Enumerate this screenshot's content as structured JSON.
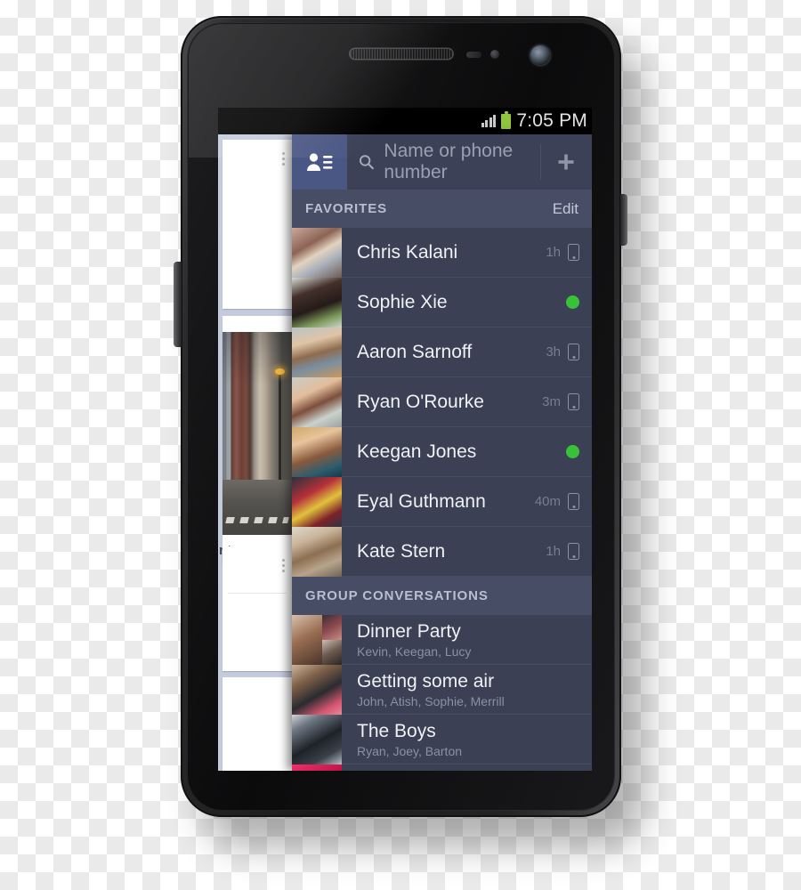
{
  "device": {
    "name": "android-smartphone",
    "hardware": {
      "earpiece": "earpiece-speaker",
      "front_camera": "front-camera",
      "proximity_sensor": "proximity-sensor",
      "light_sensor": "light-sensor",
      "volume_rocker": "volume-rocker",
      "power_button": "power-button"
    }
  },
  "status_bar": {
    "clock": "7:05 PM",
    "signal_icon": "signal-bars-icon",
    "signal_bars": 4,
    "battery_icon": "battery-full-icon",
    "battery_color": "#8ec63f"
  },
  "header": {
    "contacts_icon": "contacts-list-icon",
    "search_icon": "search-icon",
    "search_value": "",
    "search_placeholder": "Name or phone number",
    "add_icon": "plus-icon",
    "accent_color": "#4a5684"
  },
  "sections": [
    {
      "id": "favorites",
      "title": "FAVORITES",
      "action_label": "Edit",
      "rows": [
        {
          "name": "Chris Kalani",
          "time": "1h",
          "status_icon": "mobile-icon",
          "avatar": "ph-chris"
        },
        {
          "name": "Sophie Xie",
          "time": "",
          "status_icon": "online-dot",
          "avatar": "ph-sophie"
        },
        {
          "name": "Aaron Sarnoff",
          "time": "3h",
          "status_icon": "mobile-icon",
          "avatar": "ph-aaron"
        },
        {
          "name": "Ryan O'Rourke",
          "time": "3m",
          "status_icon": "mobile-icon",
          "avatar": "ph-ryan"
        },
        {
          "name": "Keegan Jones",
          "time": "",
          "status_icon": "online-dot",
          "avatar": "ph-keegan"
        },
        {
          "name": "Eyal Guthmann",
          "time": "40m",
          "status_icon": "mobile-icon",
          "avatar": "ph-eyal"
        },
        {
          "name": "Kate Stern",
          "time": "1h",
          "status_icon": "mobile-icon",
          "avatar": "ph-kate"
        }
      ]
    },
    {
      "id": "group-conversations",
      "title": "GROUP CONVERSATIONS",
      "action_label": "",
      "rows": [
        {
          "name": "Dinner Party",
          "members": "Kevin, Keegan, Lucy"
        },
        {
          "name": "Getting some air",
          "members": "John, Atish, Sophie, Merrill"
        },
        {
          "name": "The Boys",
          "members": "Ryan, Joey, Barton"
        }
      ]
    }
  ],
  "peek_feed": {
    "card_footer_text": "nt",
    "menu_icon": "overflow-menu-icon",
    "photo": "city-street-photo"
  },
  "colors": {
    "drawer_bg": "#3b4055",
    "section_header_bg": "#474d64",
    "row_divider": "#464c61",
    "name_text": "#f0f1f4",
    "sub_text": "#8b90a3",
    "online_green": "#3ac13a",
    "peek_bg": "#c3cbdd"
  }
}
